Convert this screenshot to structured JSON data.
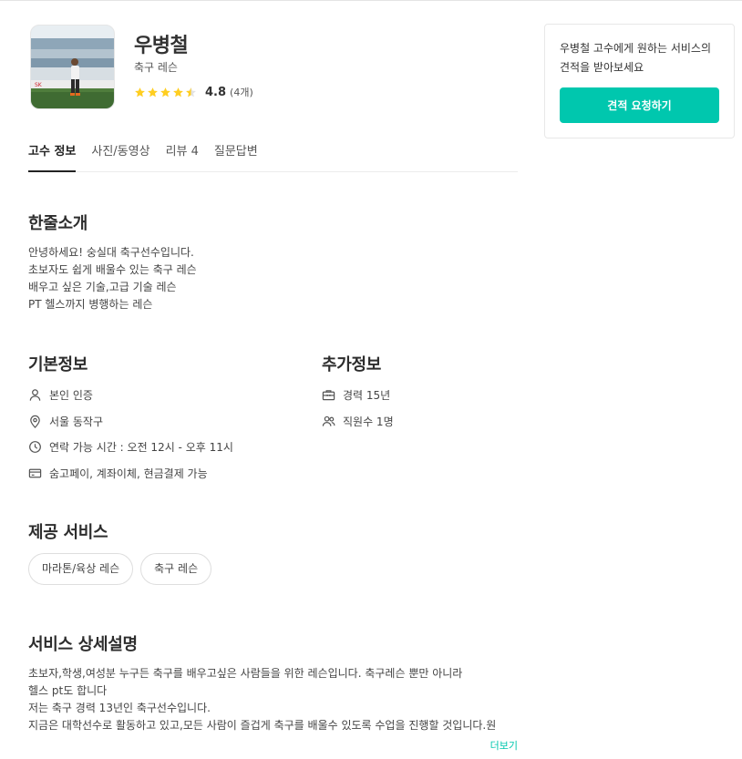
{
  "profile": {
    "name": "우병철",
    "category": "축구 레슨",
    "rating": 4.8,
    "rating_text": "4.8",
    "review_count_text": "(4개)",
    "stars_filled": 4.5
  },
  "tabs": [
    {
      "label": "고수 정보",
      "active": true
    },
    {
      "label": "사진/동영상",
      "active": false
    },
    {
      "label": "리뷰 4",
      "active": false
    },
    {
      "label": "질문답변",
      "active": false
    }
  ],
  "intro": {
    "title": "한줄소개",
    "lines": [
      "안녕하세요! 숭실대 축구선수입니다.",
      "초보자도 쉽게 배울수 있는 축구 레슨",
      "배우고 싶은 기술,고급 기술 레슨",
      "PT 헬스까지 병행하는 레슨"
    ]
  },
  "basic_info": {
    "title": "기본정보",
    "items": [
      {
        "icon": "person-icon",
        "text": "본인 인증"
      },
      {
        "icon": "location-pin-icon",
        "text": "서울 동작구"
      },
      {
        "icon": "clock-icon",
        "text": "연락 가능 시간 : 오전 12시 - 오후 11시"
      },
      {
        "icon": "payment-card-icon",
        "text": "숨고페이, 계좌이체, 현금결제 가능"
      }
    ]
  },
  "extra_info": {
    "title": "추가정보",
    "items": [
      {
        "icon": "briefcase-icon",
        "text": "경력 15년"
      },
      {
        "icon": "people-icon",
        "text": "직원수 1명"
      }
    ]
  },
  "services": {
    "title": "제공 서비스",
    "chips": [
      "마라톤/육상 레슨",
      "축구 레슨"
    ]
  },
  "details": {
    "title": "서비스 상세설명",
    "lines": [
      "초보자,학생,여성분 누구든 축구를 배우고싶은 사람들을 위한 레슨입니다. 축구레슨 뿐만 아니라",
      "헬스 pt도 합니다",
      "저는 축구 경력 13년인 축구선수입니다.",
      "지금은 대학선수로 활동하고 있고,모든 사람이 즐겁게 축구를 배울수 있도록 수업을 진행할 것입니다.원"
    ],
    "more_label": "더보기"
  },
  "sidebar": {
    "text": "우병철 고수에게 원하는 서비스의 견적을 받아보세요",
    "button_label": "견적 요청하기"
  },
  "colors": {
    "accent": "#00c7ae",
    "star": "#ffce21"
  }
}
